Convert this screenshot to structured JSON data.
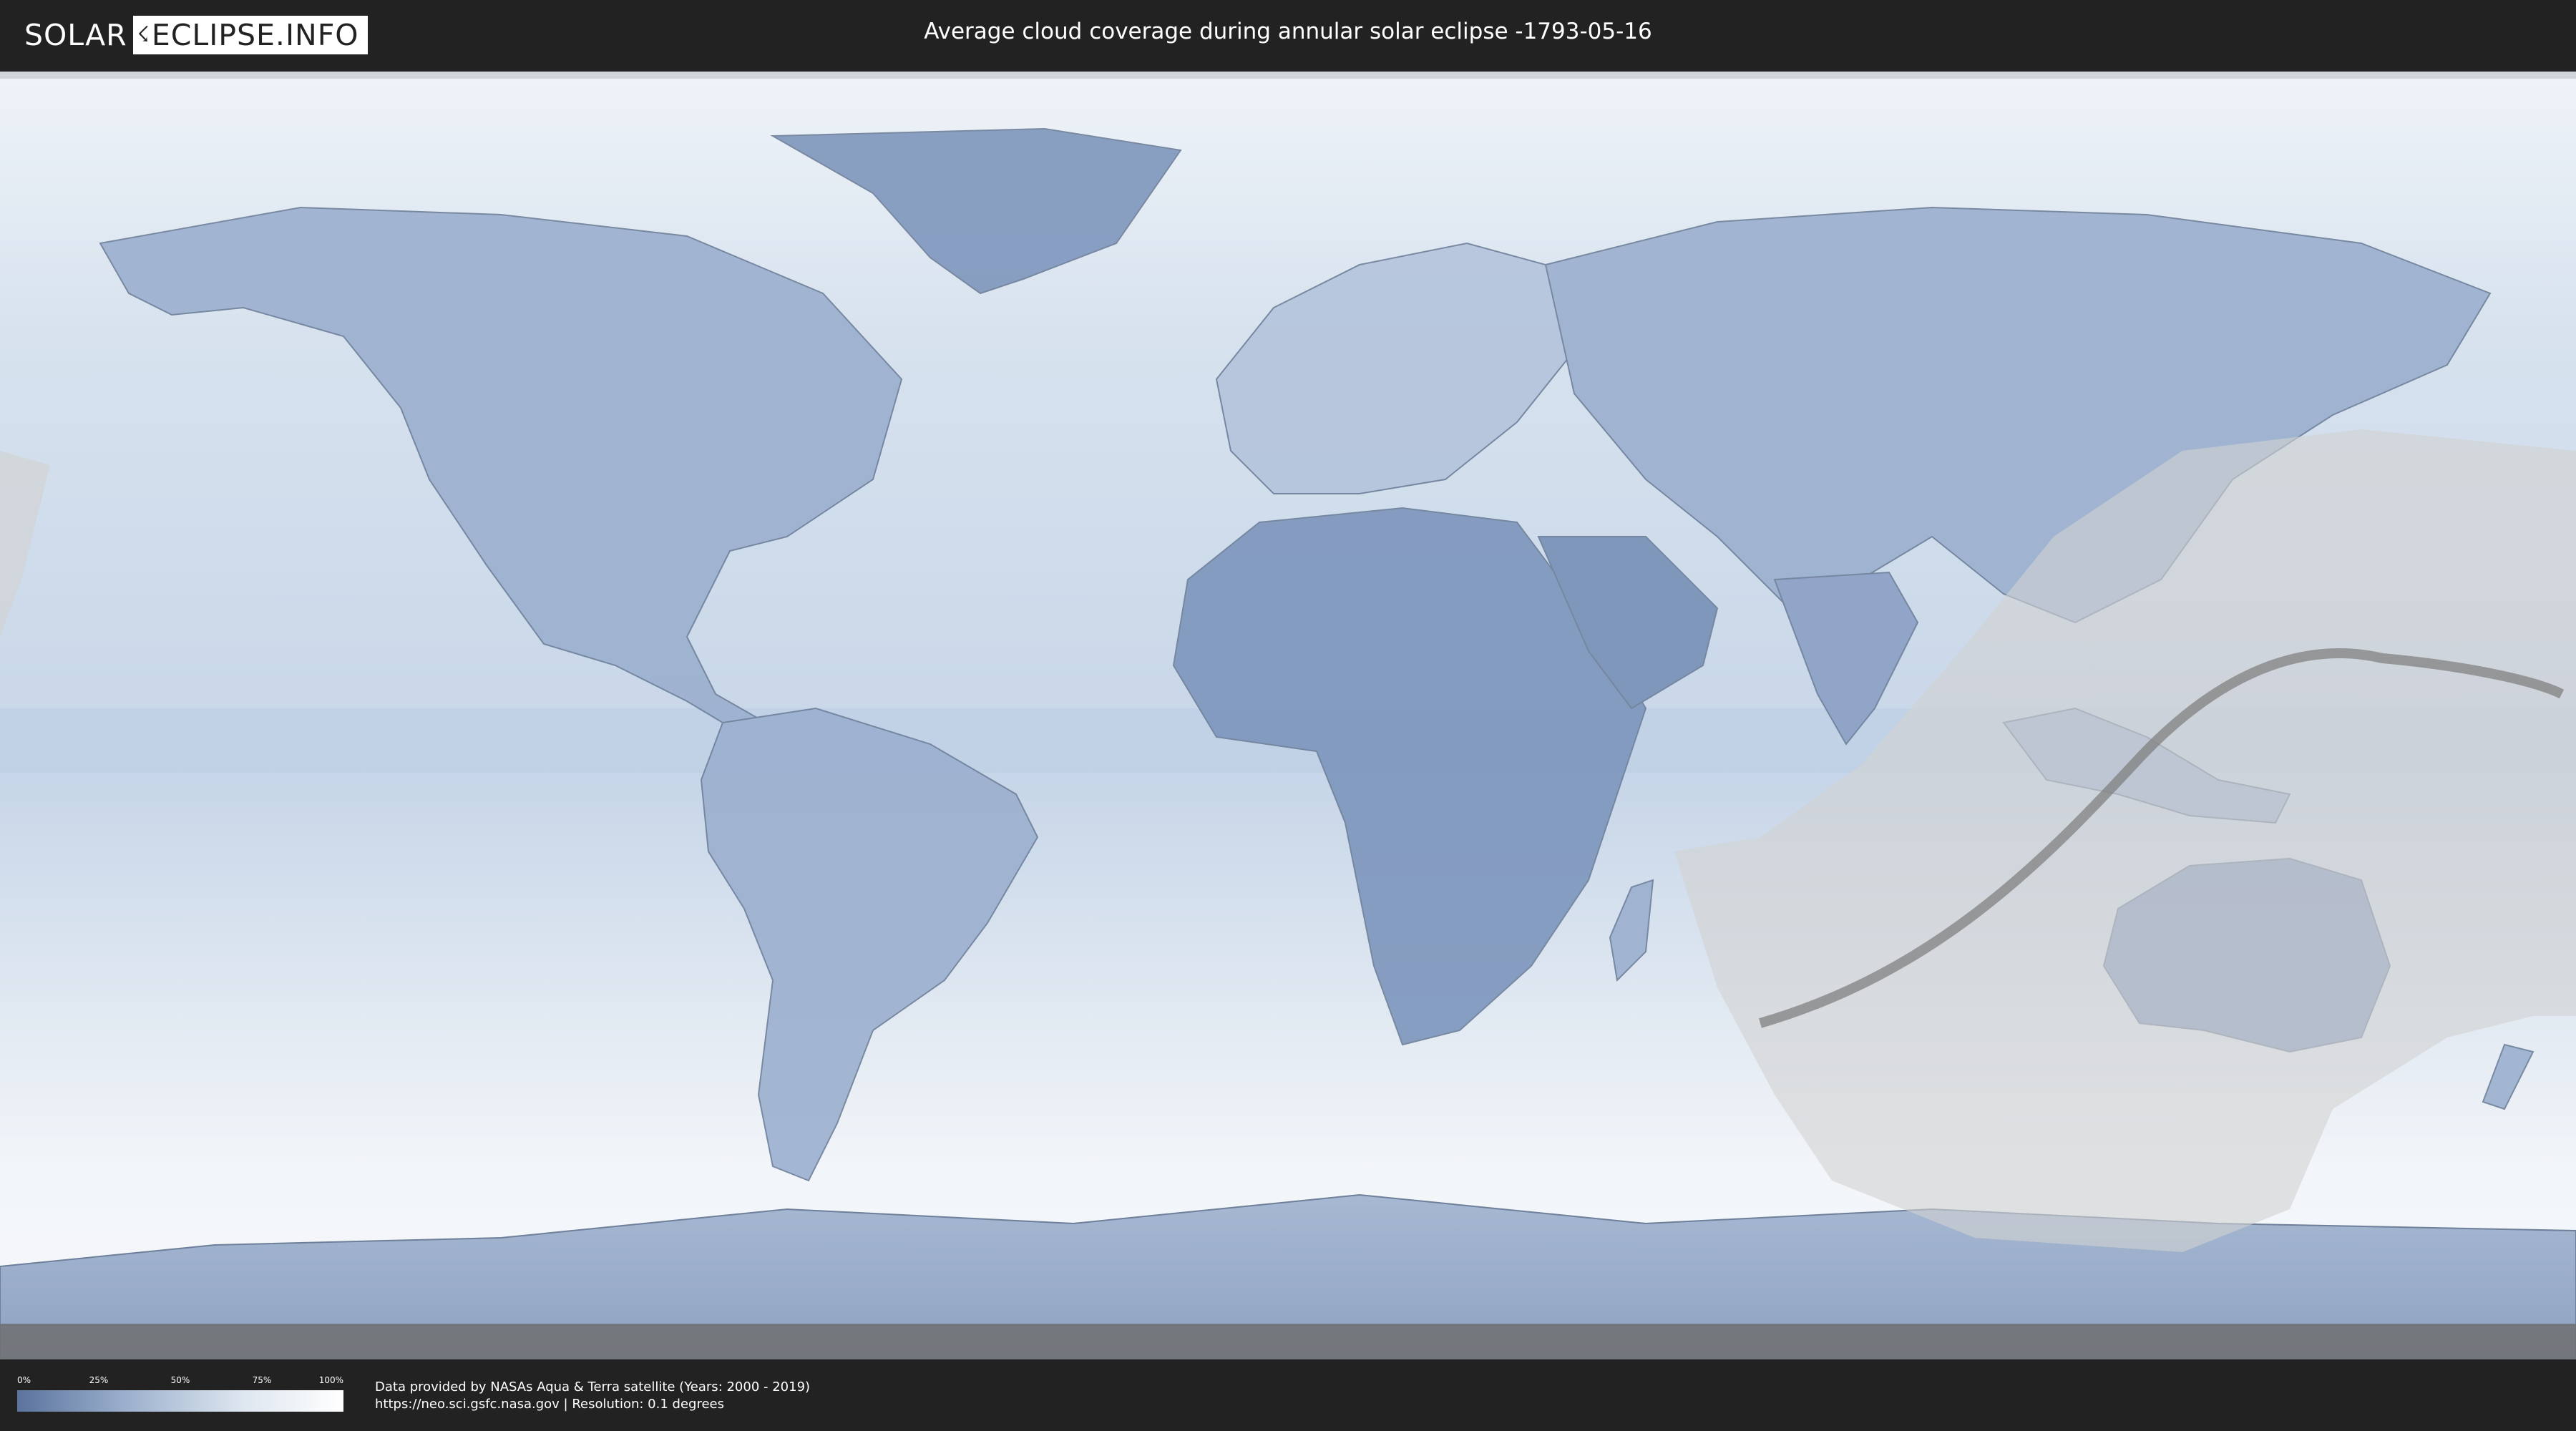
{
  "header": {
    "logo_left": "SOLAR",
    "logo_mark": "☇",
    "logo_right": "ECLIPSE.INFO",
    "title": "Average cloud coverage during annular solar eclipse -1793-05-16"
  },
  "legend": {
    "ticks": [
      "0%",
      "25%",
      "50%",
      "75%",
      "100%"
    ],
    "ticks_values": [
      0,
      25,
      50,
      75,
      100
    ],
    "color_low": "#5b739e",
    "color_high": "#ffffff"
  },
  "credits": {
    "line1": "Data provided by NASAs Aqua & Terra satellite (Years: 2000 - 2019)",
    "line2": "https://neo.sci.gsfc.nasa.gov | Resolution: 0.1 degrees"
  },
  "map": {
    "projection": "equirectangular",
    "ocean_color": "#dfe8f1",
    "land_color": "#8ea4c6",
    "eclipse_zone_color": "#d4d4d4",
    "central_line_color": "#808080"
  }
}
